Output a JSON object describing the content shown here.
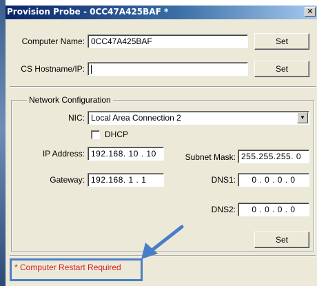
{
  "window": {
    "title": "Provision Probe - 0CC47A425BAF *",
    "close_glyph": "✕"
  },
  "computer_name": {
    "label": "Computer Name:",
    "value": "0CC47A425BAF",
    "set_label": "Set"
  },
  "cs_host": {
    "label": "CS Hostname/IP:",
    "value": "",
    "set_label": "Set"
  },
  "network": {
    "group_title": "Network Configuration",
    "nic_label": "NIC:",
    "nic_value": "Local Area Connection 2",
    "dhcp_label": "DHCP",
    "dhcp_checked": false,
    "ip_label": "IP Address:",
    "ip_value": "192.168. 10 . 10",
    "subnet_label": "Subnet Mask:",
    "subnet_value": "255.255.255. 0",
    "gateway_label": "Gateway:",
    "gateway_value": "192.168. 1 . 1",
    "dns1_label": "DNS1:",
    "dns1_value": "0 . 0 . 0 . 0",
    "dns2_label": "DNS2:",
    "dns2_value": "0 . 0 . 0 . 0",
    "set_label": "Set"
  },
  "status": {
    "text": "* Computer Restart Required",
    "color": "#d42020"
  },
  "annotation": {
    "color": "#4a7dc8",
    "icon": "arrow-icon"
  }
}
